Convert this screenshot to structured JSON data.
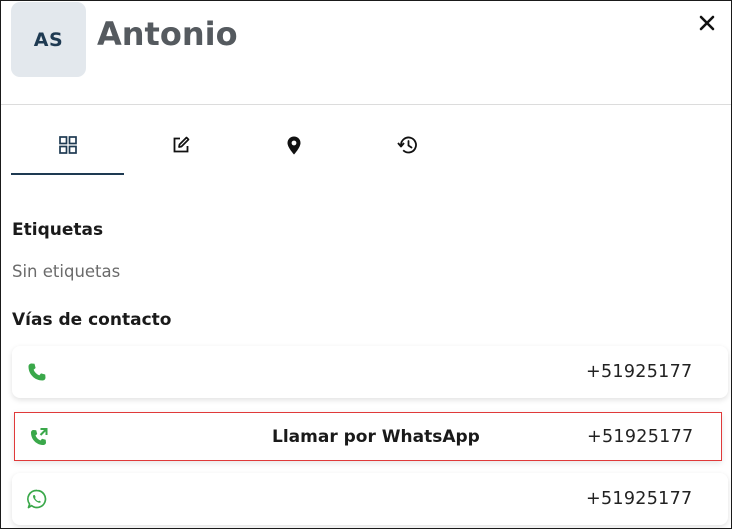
{
  "contact": {
    "initials": "AS",
    "name": "Antonio"
  },
  "header": {
    "close_icon": "close-icon"
  },
  "tabs": [
    {
      "icon": "grid-icon",
      "active": true
    },
    {
      "icon": "edit-icon",
      "active": false
    },
    {
      "icon": "location-pin-icon",
      "active": false
    },
    {
      "icon": "history-icon",
      "active": false
    }
  ],
  "labels": {
    "title": "Etiquetas",
    "empty": "Sin etiquetas"
  },
  "contact_methods": {
    "title": "Vías de contacto",
    "items": [
      {
        "icon": "phone-icon",
        "number": "+51925177",
        "action_label": ""
      },
      {
        "icon": "phone-forward-icon",
        "number": "+51925177",
        "action_label": "Llamar por WhatsApp"
      },
      {
        "icon": "whatsapp-icon",
        "number": "+51925177",
        "action_label": ""
      }
    ]
  },
  "colors": {
    "accent": "#1e3a52",
    "avatar_bg": "#e3e8ed",
    "icon_green": "#3aa84a",
    "highlight_border": "#e03a3a"
  }
}
